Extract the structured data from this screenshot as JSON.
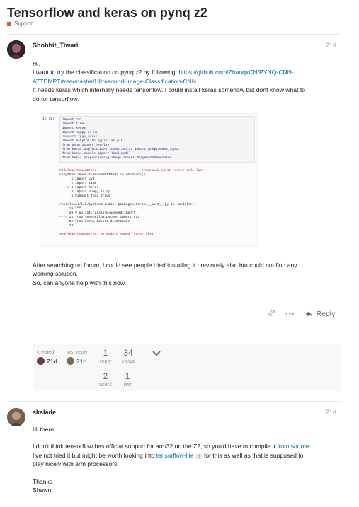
{
  "topic": {
    "title": "Tensorflow and keras on pynq z2",
    "category": "Support",
    "category_color": "#e45735"
  },
  "post1": {
    "username": "Shobhit_Tiwari",
    "date": "21d",
    "greeting": "Hi,",
    "line1_prefix": "I want to try the classification on pynq z2 by following: ",
    "link_line1": "https://github.com/ZhaoqxCN/PYNQ-CNN-",
    "link_line2": "ATTEMPT/tree/master/Ultrasound-Image-Classification-CNN",
    "line2": "It needs keras which internally needs tensorflow. I could install keras somehow but dont know what to",
    "line3": "do for tensorflow.",
    "code": {
      "prompt": "In [1]:",
      "lines": [
        "import cv2",
        "import time",
        "import keras",
        "import numpy as np",
        "#import fpga_drive",
        "import matplotlib.pyplot as plt",
        "from pynq import Overlay",
        "from keras.applications.inception_v3 import preprocess_input",
        "from keras.models import load_model",
        "from keras.preprocessing.image import ImageDataGenerator"
      ],
      "error_lines": [
        "ModuleNotFoundError                       Traceback (most recent call last)",
        "<ipython-input-1-3cde380f296d> in <module>()",
        "      1 import cv2",
        "      2 import time",
        "----> 3 import keras",
        "      4 import numpy as np",
        "      5 #import fpga_drive",
        "",
        "/usr/local/lib/python3.6/dist-packages/keras/__init__.py in <module>()",
        "     19 \"\"\"",
        "     20 # pylint: disable=unused-import",
        "---> 21 from tensorflow.python import tf2",
        "     22 from keras import distribute",
        "     23",
        "",
        "ModuleNotFoundError: No module named 'tensorflow'"
      ]
    },
    "after1": "After searching on forum, I could see people tried installing it previously also btu could not find any",
    "after2": "working solution.",
    "after3": "So, can anyone help with this now.",
    "reply_label": "Reply",
    "summary": {
      "created_label": "created",
      "created_date": "21d",
      "last_reply_label": "last reply",
      "last_reply_date": "21d",
      "replies_num": "1",
      "replies_label": "reply",
      "views_num": "34",
      "views_label": "views",
      "users_num": "2",
      "users_label": "users",
      "link_num": "1",
      "link_label": "link"
    }
  },
  "post2": {
    "username": "skalade",
    "date": "21d",
    "greeting": "Hi there,",
    "p1_a": "I don't think tensorflow has official support for arm32 on the Z2, so you'd have to compile it ",
    "p1_link": "from source",
    "p1_b": ".",
    "p2_a": "I've not tried it but might be worth looking into ",
    "p2_link": "tensorflow-lite",
    "p2_badge": "3",
    "p2_b": " for this as well as that is supposed to",
    "p3": "play nicely with arm processors.",
    "thanks": "Thanks",
    "signature": "Shawn"
  }
}
